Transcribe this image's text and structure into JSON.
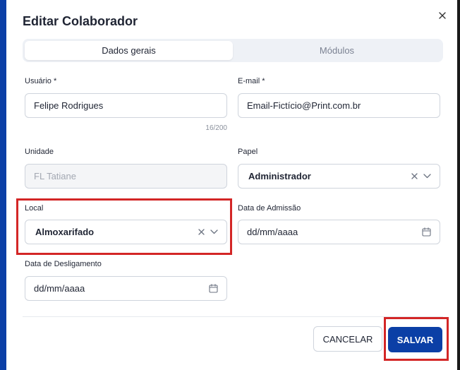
{
  "dialog": {
    "title": "Editar Colaborador"
  },
  "tabs": [
    {
      "label": "Dados gerais",
      "active": true
    },
    {
      "label": "Módulos",
      "active": false
    }
  ],
  "form": {
    "usuario": {
      "label": "Usuário *",
      "value": "Felipe Rodrigues",
      "counter": "16/200"
    },
    "email": {
      "label": "E-mail *",
      "value": "Email-Fictício@Print.com.br"
    },
    "unidade": {
      "label": "Unidade",
      "value": "FL Tatiane"
    },
    "papel": {
      "label": "Papel",
      "value": "Administrador"
    },
    "local": {
      "label": "Local",
      "value": "Almoxarifado"
    },
    "admissao": {
      "label": "Data de Admissão",
      "placeholder": "dd/mm/aaaa"
    },
    "desligamento": {
      "label": "Data de Desligamento",
      "placeholder": "dd/mm/aaaa"
    }
  },
  "actions": {
    "cancel": "CANCELAR",
    "save": "SALVAR"
  },
  "colors": {
    "primary": "#0b3fa6",
    "highlight": "#d32626"
  }
}
